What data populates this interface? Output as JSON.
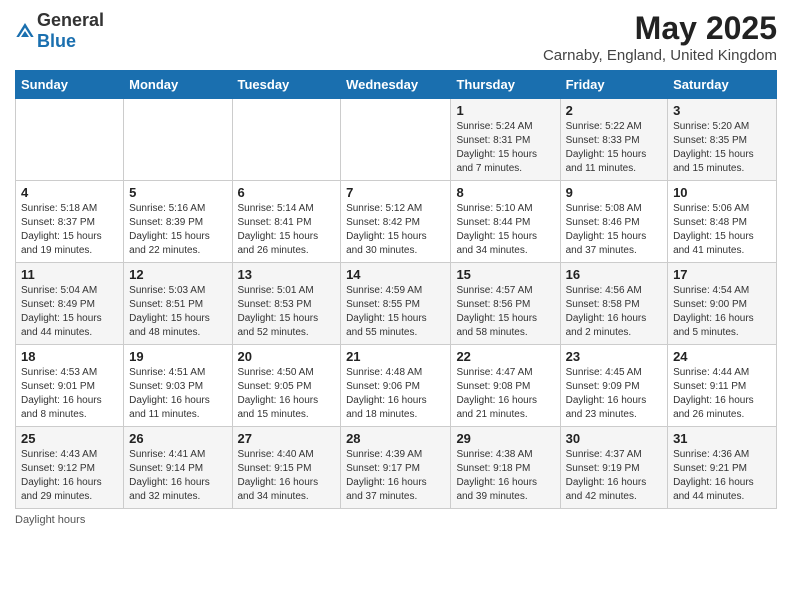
{
  "header": {
    "logo_general": "General",
    "logo_blue": "Blue",
    "title": "May 2025",
    "subtitle": "Carnaby, England, United Kingdom"
  },
  "days_of_week": [
    "Sunday",
    "Monday",
    "Tuesday",
    "Wednesday",
    "Thursday",
    "Friday",
    "Saturday"
  ],
  "weeks": [
    [
      {
        "day": "",
        "info": ""
      },
      {
        "day": "",
        "info": ""
      },
      {
        "day": "",
        "info": ""
      },
      {
        "day": "",
        "info": ""
      },
      {
        "day": "1",
        "info": "Sunrise: 5:24 AM\nSunset: 8:31 PM\nDaylight: 15 hours\nand 7 minutes."
      },
      {
        "day": "2",
        "info": "Sunrise: 5:22 AM\nSunset: 8:33 PM\nDaylight: 15 hours\nand 11 minutes."
      },
      {
        "day": "3",
        "info": "Sunrise: 5:20 AM\nSunset: 8:35 PM\nDaylight: 15 hours\nand 15 minutes."
      }
    ],
    [
      {
        "day": "4",
        "info": "Sunrise: 5:18 AM\nSunset: 8:37 PM\nDaylight: 15 hours\nand 19 minutes."
      },
      {
        "day": "5",
        "info": "Sunrise: 5:16 AM\nSunset: 8:39 PM\nDaylight: 15 hours\nand 22 minutes."
      },
      {
        "day": "6",
        "info": "Sunrise: 5:14 AM\nSunset: 8:41 PM\nDaylight: 15 hours\nand 26 minutes."
      },
      {
        "day": "7",
        "info": "Sunrise: 5:12 AM\nSunset: 8:42 PM\nDaylight: 15 hours\nand 30 minutes."
      },
      {
        "day": "8",
        "info": "Sunrise: 5:10 AM\nSunset: 8:44 PM\nDaylight: 15 hours\nand 34 minutes."
      },
      {
        "day": "9",
        "info": "Sunrise: 5:08 AM\nSunset: 8:46 PM\nDaylight: 15 hours\nand 37 minutes."
      },
      {
        "day": "10",
        "info": "Sunrise: 5:06 AM\nSunset: 8:48 PM\nDaylight: 15 hours\nand 41 minutes."
      }
    ],
    [
      {
        "day": "11",
        "info": "Sunrise: 5:04 AM\nSunset: 8:49 PM\nDaylight: 15 hours\nand 44 minutes."
      },
      {
        "day": "12",
        "info": "Sunrise: 5:03 AM\nSunset: 8:51 PM\nDaylight: 15 hours\nand 48 minutes."
      },
      {
        "day": "13",
        "info": "Sunrise: 5:01 AM\nSunset: 8:53 PM\nDaylight: 15 hours\nand 52 minutes."
      },
      {
        "day": "14",
        "info": "Sunrise: 4:59 AM\nSunset: 8:55 PM\nDaylight: 15 hours\nand 55 minutes."
      },
      {
        "day": "15",
        "info": "Sunrise: 4:57 AM\nSunset: 8:56 PM\nDaylight: 15 hours\nand 58 minutes."
      },
      {
        "day": "16",
        "info": "Sunrise: 4:56 AM\nSunset: 8:58 PM\nDaylight: 16 hours\nand 2 minutes."
      },
      {
        "day": "17",
        "info": "Sunrise: 4:54 AM\nSunset: 9:00 PM\nDaylight: 16 hours\nand 5 minutes."
      }
    ],
    [
      {
        "day": "18",
        "info": "Sunrise: 4:53 AM\nSunset: 9:01 PM\nDaylight: 16 hours\nand 8 minutes."
      },
      {
        "day": "19",
        "info": "Sunrise: 4:51 AM\nSunset: 9:03 PM\nDaylight: 16 hours\nand 11 minutes."
      },
      {
        "day": "20",
        "info": "Sunrise: 4:50 AM\nSunset: 9:05 PM\nDaylight: 16 hours\nand 15 minutes."
      },
      {
        "day": "21",
        "info": "Sunrise: 4:48 AM\nSunset: 9:06 PM\nDaylight: 16 hours\nand 18 minutes."
      },
      {
        "day": "22",
        "info": "Sunrise: 4:47 AM\nSunset: 9:08 PM\nDaylight: 16 hours\nand 21 minutes."
      },
      {
        "day": "23",
        "info": "Sunrise: 4:45 AM\nSunset: 9:09 PM\nDaylight: 16 hours\nand 23 minutes."
      },
      {
        "day": "24",
        "info": "Sunrise: 4:44 AM\nSunset: 9:11 PM\nDaylight: 16 hours\nand 26 minutes."
      }
    ],
    [
      {
        "day": "25",
        "info": "Sunrise: 4:43 AM\nSunset: 9:12 PM\nDaylight: 16 hours\nand 29 minutes."
      },
      {
        "day": "26",
        "info": "Sunrise: 4:41 AM\nSunset: 9:14 PM\nDaylight: 16 hours\nand 32 minutes."
      },
      {
        "day": "27",
        "info": "Sunrise: 4:40 AM\nSunset: 9:15 PM\nDaylight: 16 hours\nand 34 minutes."
      },
      {
        "day": "28",
        "info": "Sunrise: 4:39 AM\nSunset: 9:17 PM\nDaylight: 16 hours\nand 37 minutes."
      },
      {
        "day": "29",
        "info": "Sunrise: 4:38 AM\nSunset: 9:18 PM\nDaylight: 16 hours\nand 39 minutes."
      },
      {
        "day": "30",
        "info": "Sunrise: 4:37 AM\nSunset: 9:19 PM\nDaylight: 16 hours\nand 42 minutes."
      },
      {
        "day": "31",
        "info": "Sunrise: 4:36 AM\nSunset: 9:21 PM\nDaylight: 16 hours\nand 44 minutes."
      }
    ]
  ],
  "footer": {
    "note": "Daylight hours"
  }
}
